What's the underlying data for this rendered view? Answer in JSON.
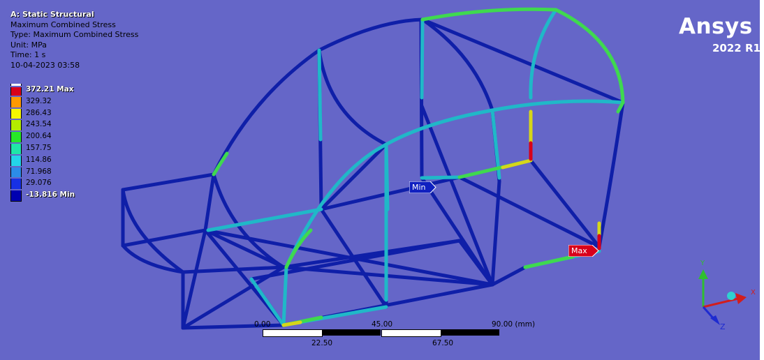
{
  "header": {
    "title": "A: Static Structural",
    "lines": [
      "Maximum Combined Stress",
      "Type: Maximum Combined Stress",
      "Unit: MPa",
      "Time: 1 s",
      "10-04-2023 03:58"
    ]
  },
  "legend": {
    "entries": [
      {
        "label": "372.21 Max",
        "color": "#d8001a"
      },
      {
        "label": "329.32",
        "color": "#ff9900"
      },
      {
        "label": "286.43",
        "color": "#f6f600"
      },
      {
        "label": "243.54",
        "color": "#b4ec00"
      },
      {
        "label": "200.64",
        "color": "#27e827"
      },
      {
        "label": "157.75",
        "color": "#20e6a8"
      },
      {
        "label": "114.86",
        "color": "#24d5e8"
      },
      {
        "label": "71.968",
        "color": "#2c8ce8"
      },
      {
        "label": "29.076",
        "color": "#1730e5"
      },
      {
        "label": "-13.816 Min",
        "color": "#0000b0"
      }
    ]
  },
  "logo": {
    "brand": "Ansys",
    "version": "2022 R1"
  },
  "probes": {
    "min": "Min",
    "max": "Max"
  },
  "scale": {
    "top_labels": [
      "0.00",
      "45.00",
      "90.00 (mm)"
    ],
    "bottom_labels": [
      "22.50",
      "67.50"
    ]
  },
  "triad": {
    "x": "X",
    "y": "Y",
    "z": "Z"
  },
  "colors": {
    "background": "#6566c8",
    "frame_blue": "#0f1fa8",
    "frame_cyan": "#20b8c8",
    "frame_green": "#3fd94f",
    "frame_yellow": "#d6d61a",
    "frame_red": "#d8001a"
  }
}
